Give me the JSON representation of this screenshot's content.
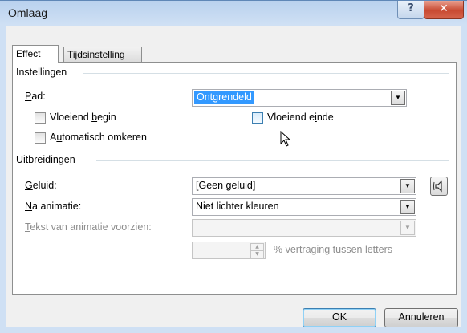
{
  "window": {
    "title": "Omlaag"
  },
  "titlebar": {
    "help_label": "?",
    "close_label": "✕"
  },
  "tabs": [
    {
      "label": "Effect",
      "active": true
    },
    {
      "label": "Tijdsinstelling",
      "active": false
    }
  ],
  "settings": {
    "group_title": "Instellingen",
    "path": {
      "label_u": "P",
      "label_rest": "ad:",
      "value": "Ontgrendeld"
    },
    "smooth_start": {
      "label_pre": "Vloeiend ",
      "label_u": "b",
      "label_post": "egin",
      "checked": false
    },
    "smooth_end": {
      "label_pre": "Vloeiend e",
      "label_u": "i",
      "label_post": "nde",
      "checked": false
    },
    "auto_reverse": {
      "label_pre": "A",
      "label_u": "u",
      "label_post": "tomatisch omkeren",
      "checked": false
    }
  },
  "enhancements": {
    "group_title": "Uitbreidingen",
    "sound": {
      "label_u": "G",
      "label_rest": "eluid:",
      "value": "[Geen geluid]"
    },
    "after_animation": {
      "label_u": "N",
      "label_rest": "a animatie:",
      "value": "Niet lichter kleuren"
    },
    "animate_text": {
      "label_u": "T",
      "label_rest": "ekst van animatie voorzien:",
      "value": ""
    },
    "delay": {
      "value": "",
      "label_pre": "% vertraging tussen ",
      "label_u": "l",
      "label_post": "etters"
    }
  },
  "buttons": {
    "ok": "OK",
    "cancel": "Annuleren"
  },
  "icons": {
    "help": "help-icon",
    "close": "close-icon",
    "dropdown": "chevron-down-icon",
    "sound": "speaker-icon",
    "cursor": "mouse-pointer-icon"
  }
}
